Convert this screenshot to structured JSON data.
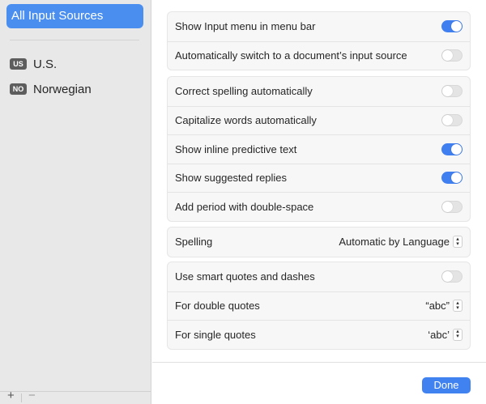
{
  "sidebar": {
    "selected_label": "All Input Sources",
    "sources": [
      {
        "badge": "US",
        "label": "U.S."
      },
      {
        "badge": "NO",
        "label": "Norwegian"
      }
    ],
    "add_symbol": "+",
    "remove_symbol": "−"
  },
  "groups": {
    "menu": [
      {
        "label": "Show Input menu in menu bar",
        "toggle": "on"
      },
      {
        "label": "Automatically switch to a document’s input source",
        "toggle": "off"
      }
    ],
    "typing": [
      {
        "label": "Correct spelling automatically",
        "toggle": "off"
      },
      {
        "label": "Capitalize words automatically",
        "toggle": "off"
      },
      {
        "label": "Show inline predictive text",
        "toggle": "on"
      },
      {
        "label": "Show suggested replies",
        "toggle": "on"
      },
      {
        "label": "Add period with double-space",
        "toggle": "off"
      }
    ],
    "spelling": {
      "label": "Spelling",
      "value": "Automatic by Language"
    },
    "quotes": {
      "smart": {
        "label": "Use smart quotes and dashes",
        "toggle": "off"
      },
      "double": {
        "label": "For double quotes",
        "value": "“abc”"
      },
      "single": {
        "label": "For single quotes",
        "value": "‘abc’"
      }
    }
  },
  "footer": {
    "done_label": "Done"
  },
  "colors": {
    "accent": "#3f82f0",
    "sidebar_bg": "#e8e8e8",
    "group_bg": "#f7f7f7"
  }
}
